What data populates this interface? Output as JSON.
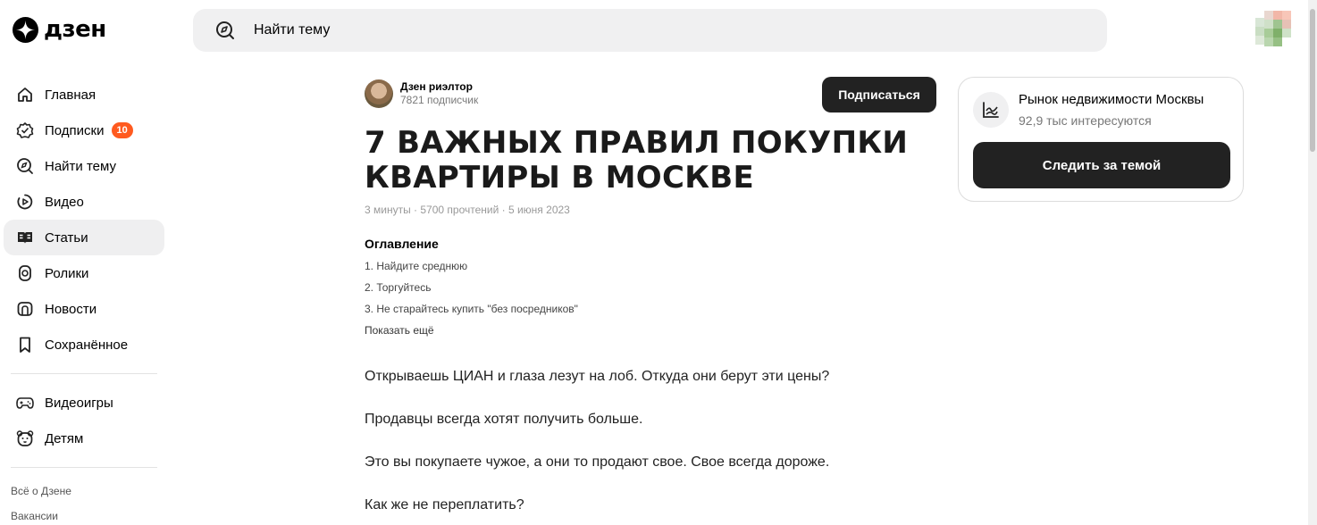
{
  "app": {
    "logo_text": "дзен"
  },
  "search": {
    "placeholder": "Найти тему"
  },
  "sidebar": {
    "items": [
      {
        "label": "Главная",
        "icon": "home-icon"
      },
      {
        "label": "Подписки",
        "icon": "subscriptions-icon",
        "badge": "10"
      },
      {
        "label": "Найти тему",
        "icon": "compass-icon"
      },
      {
        "label": "Видео",
        "icon": "video-icon"
      },
      {
        "label": "Статьи",
        "icon": "articles-icon",
        "active": true
      },
      {
        "label": "Ролики",
        "icon": "shorts-icon"
      },
      {
        "label": "Новости",
        "icon": "news-icon"
      },
      {
        "label": "Сохранённое",
        "icon": "bookmark-icon"
      }
    ],
    "extra_items": [
      {
        "label": "Видеоигры",
        "icon": "gamepad-icon"
      },
      {
        "label": "Детям",
        "icon": "kids-icon"
      }
    ],
    "footer_links": [
      "Всё о Дзене",
      "Вакансии"
    ]
  },
  "article": {
    "author_name": "Дзен риэлтор",
    "author_subscribers": "7821 подписчик",
    "subscribe_label": "Подписаться",
    "title": "7 ВАЖНЫХ ПРАВИЛ ПОКУПКИ КВАРТИРЫ В МОСКВЕ",
    "meta": "3 минуты · 5700 прочтений · 5 июня 2023",
    "toc_heading": "Оглавление",
    "toc": [
      "1. Найдите среднюю",
      "2. Торгуйтесь",
      "3. Не старайтесь купить \"без посредников\""
    ],
    "toc_more": "Показать ещё",
    "paragraphs": [
      "Открываешь ЦИАН и глаза лезут на лоб. Откуда они берут эти цены?",
      "Продавцы всегда хотят получить больше.",
      "Это вы покупаете чужое, а они то продают свое. Свое всегда дороже.",
      "Как же не переплатить?"
    ]
  },
  "topic": {
    "name": "Рынок недвижимости Москвы",
    "count": "92,9 тыс интересуются",
    "follow_label": "Следить за темой",
    "icon": "chart-line-icon"
  },
  "colors": {
    "accent_dark": "#222222",
    "badge": "#ff5a1f",
    "active_bg": "#efeff0"
  }
}
